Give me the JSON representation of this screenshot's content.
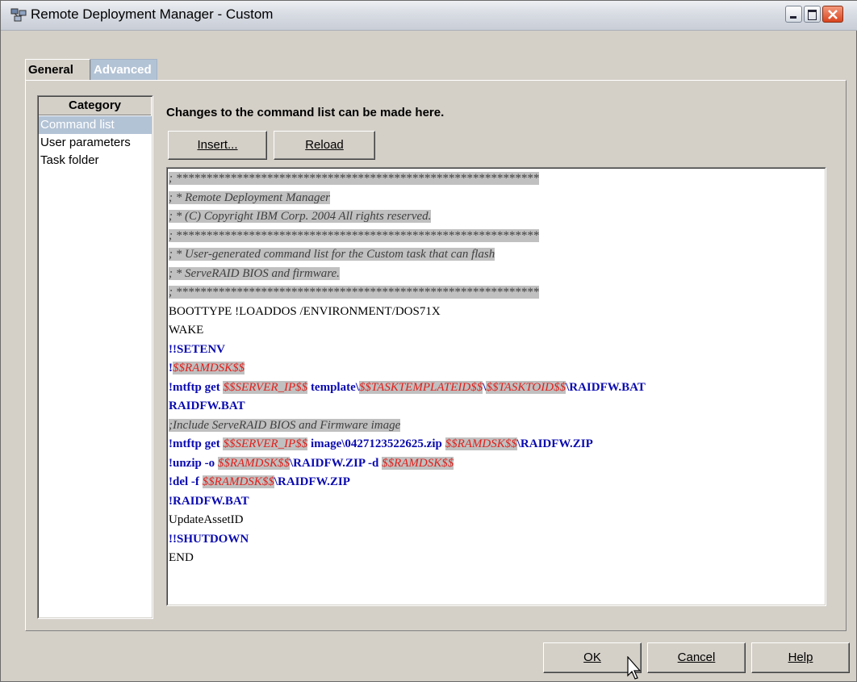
{
  "window": {
    "title": "Remote Deployment Manager - Custom",
    "icon": "network-computers-icon"
  },
  "tabs": [
    {
      "label": "General",
      "selected": true
    },
    {
      "label": "Advanced",
      "selected": false
    }
  ],
  "category": {
    "header": "Category",
    "items": [
      {
        "label": "Command list",
        "selected": true
      },
      {
        "label": "User parameters",
        "selected": false
      },
      {
        "label": "Task folder",
        "selected": false
      }
    ]
  },
  "main": {
    "heading": "Changes to the command list can be made here.",
    "insert_label": "Insert...",
    "reload_label": "Reload"
  },
  "command_list": [
    [
      {
        "t": "comment",
        "v": "; ************************************************************"
      }
    ],
    [
      {
        "t": "comment",
        "v": "; * Remote Deployment Manager"
      }
    ],
    [
      {
        "t": "comment",
        "v": "; * (C) Copyright IBM Corp. 2004 All rights reserved."
      }
    ],
    [
      {
        "t": "comment",
        "v": "; ************************************************************"
      }
    ],
    [
      {
        "t": "comment",
        "v": "; * User-generated command list for the Custom task that can flash"
      }
    ],
    [
      {
        "t": "comment",
        "v": "; * ServeRAID BIOS and firmware."
      }
    ],
    [
      {
        "t": "comment",
        "v": "; ************************************************************"
      }
    ],
    [
      {
        "t": "plain",
        "v": "BOOTTYPE !LOADDOS /ENVIRONMENT/DOS71X"
      }
    ],
    [
      {
        "t": "plain",
        "v": "WAKE"
      }
    ],
    [
      {
        "t": "cmd",
        "v": "!!SETENV"
      }
    ],
    [
      {
        "t": "cmd",
        "v": "!"
      },
      {
        "t": "var",
        "v": "$$RAMDSK$$"
      }
    ],
    [
      {
        "t": "cmd",
        "v": "!mtftp get "
      },
      {
        "t": "var",
        "v": "$$SERVER_IP$$"
      },
      {
        "t": "cmd",
        "v": " template\\"
      },
      {
        "t": "var",
        "v": "$$TASKTEMPLATEID$$"
      },
      {
        "t": "cmd",
        "v": "\\"
      },
      {
        "t": "var",
        "v": "$$TASKTOID$$"
      },
      {
        "t": "cmd",
        "v": "\\RAIDFW.BAT"
      }
    ],
    [
      {
        "t": "cmd",
        "v": "RAIDFW.BAT"
      }
    ],
    [
      {
        "t": "comment",
        "v": ";Include ServeRAID BIOS and Firmware image"
      }
    ],
    [
      {
        "t": "cmd",
        "v": "!mtftp get "
      },
      {
        "t": "var",
        "v": "$$SERVER_IP$$"
      },
      {
        "t": "cmd",
        "v": " image\\0427123522625.zip "
      },
      {
        "t": "var",
        "v": "$$RAMDSK$$"
      },
      {
        "t": "cmd",
        "v": "\\RAIDFW.ZIP"
      }
    ],
    [
      {
        "t": "cmd",
        "v": "!unzip -o "
      },
      {
        "t": "var",
        "v": "$$RAMDSK$$"
      },
      {
        "t": "cmd",
        "v": "\\RAIDFW.ZIP -d "
      },
      {
        "t": "var",
        "v": "$$RAMDSK$$"
      }
    ],
    [
      {
        "t": "cmd",
        "v": "!del -f "
      },
      {
        "t": "var",
        "v": "$$RAMDSK$$"
      },
      {
        "t": "cmd",
        "v": "\\RAIDFW.ZIP"
      }
    ],
    [
      {
        "t": "cmd",
        "v": "!RAIDFW.BAT"
      }
    ],
    [
      {
        "t": "plain",
        "v": "UpdateAssetID"
      }
    ],
    [
      {
        "t": "cmd",
        "v": "!!SHUTDOWN"
      }
    ],
    [
      {
        "t": "plain",
        "v": "END"
      }
    ]
  ],
  "footer": {
    "ok_label": "OK",
    "cancel_label": "Cancel",
    "help_label": "Help"
  },
  "colors": {
    "selection": "#b3c3d6",
    "command": "#0a0ab0",
    "variable": "#e0201c",
    "comment_bg": "#c0c0c0"
  }
}
